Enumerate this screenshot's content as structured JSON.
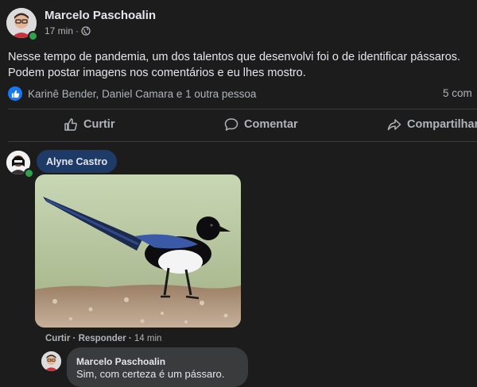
{
  "post": {
    "author": "Marcelo Paschoalin",
    "time": "17 min",
    "separator": "·",
    "text_line1": "Nesse tempo de pandemia, um dos talentos que desenvolvi foi o de identificar pássaros.",
    "text_line2": "Podem postar imagens nos comentários e eu lhes mostro.",
    "reactions_text": "Karinê Bender, Daniel Camara e 1 outra pessoa",
    "comment_count": "5 com"
  },
  "actions": {
    "like": "Curtir",
    "comment": "Comentar",
    "share": "Compartilhar"
  },
  "comment": {
    "author": "Alyne Castro",
    "like": "Curtir",
    "reply": "Responder",
    "dot": "·",
    "time": "14 min"
  },
  "reply": {
    "author": "Marcelo Paschoalin",
    "text": "Sim, com certeza é um pássaro."
  },
  "colors": {
    "background": "#1c1c1d",
    "accent": "#1877f2",
    "name_bubble": "#1d3b66",
    "online": "#31a24c"
  },
  "icons": {
    "privacy": "globe-icon",
    "reaction": "thumbs-up-icon",
    "like": "thumbs-up-outline-icon",
    "comment": "speech-bubble-icon",
    "share": "share-arrow-icon"
  }
}
